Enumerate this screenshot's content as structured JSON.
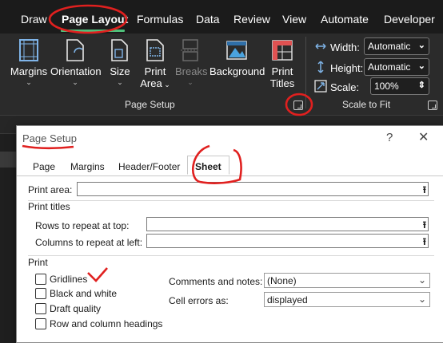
{
  "ribbon_tabs": [
    "Draw",
    "Page Layout",
    "Formulas",
    "Data",
    "Review",
    "View",
    "Automate",
    "Developer"
  ],
  "ribbon": {
    "margins": "Margins",
    "orientation": "Orientation",
    "size": "Size",
    "print_area_line1": "Print",
    "print_area_line2": "Area",
    "breaks": "Breaks",
    "background": "Background",
    "print_titles_line1": "Print",
    "print_titles_line2": "Titles",
    "page_setup_group": "Page Setup",
    "scale_to_fit_group": "Scale to Fit",
    "width_label": "Width:",
    "width_value": "Automatic",
    "height_label": "Height:",
    "height_value": "Automatic",
    "scale_label": "Scale:",
    "scale_value": "100%"
  },
  "dialog": {
    "title": "Page Setup",
    "help": "?",
    "close": "✕",
    "tabs": [
      "Page",
      "Margins",
      "Header/Footer",
      "Sheet"
    ],
    "active_tab": "Sheet",
    "print_area_label": "Print area:",
    "print_titles_heading": "Print titles",
    "rows_repeat_label": "Rows to repeat at top:",
    "cols_repeat_label": "Columns to repeat at left:",
    "print_heading": "Print",
    "checkboxes": [
      {
        "label": "Gridlines",
        "checked": false
      },
      {
        "label": "Black and white",
        "checked": false
      },
      {
        "label": "Draft quality",
        "checked": false
      },
      {
        "label": "Row and column headings",
        "checked": false
      }
    ],
    "comments_label": "Comments and notes:",
    "comments_value": "(None)",
    "cell_errors_label": "Cell errors as:",
    "cell_errors_value": "displayed"
  },
  "colors": {
    "annotation": "#e0201f",
    "ribbon_bg": "#2b2b2b",
    "active_tab_underline": "#4fbf7a"
  }
}
